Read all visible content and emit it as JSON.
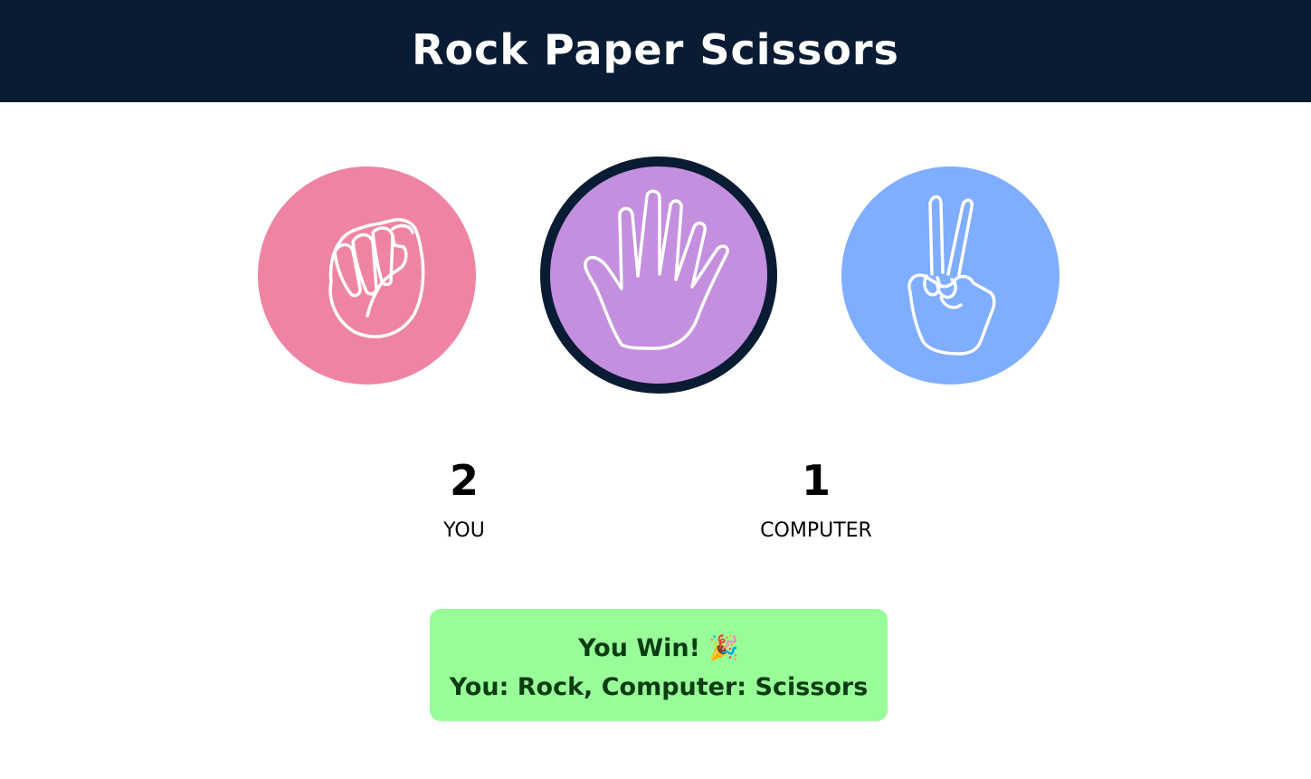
{
  "header": {
    "title": "Rock Paper Scissors"
  },
  "choices": [
    {
      "name": "Rock",
      "color": "#ef84a2",
      "icon": "fist-icon"
    },
    {
      "name": "Paper",
      "color": "#c48fde",
      "icon": "open-hand-icon",
      "selected": true
    },
    {
      "name": "Scissors",
      "color": "#7fadff",
      "icon": "peace-sign-icon"
    }
  ],
  "scores": {
    "you": {
      "value": "2",
      "label": "YOU"
    },
    "computer": {
      "value": "1",
      "label": "COMPUTER"
    }
  },
  "result": {
    "headline": "You Win! 🎉",
    "detail": "You: Rock, Computer: Scissors",
    "background": "#98fd98"
  },
  "colors": {
    "header_bg": "#0a1c33",
    "selected_border": "#0a1c33"
  }
}
